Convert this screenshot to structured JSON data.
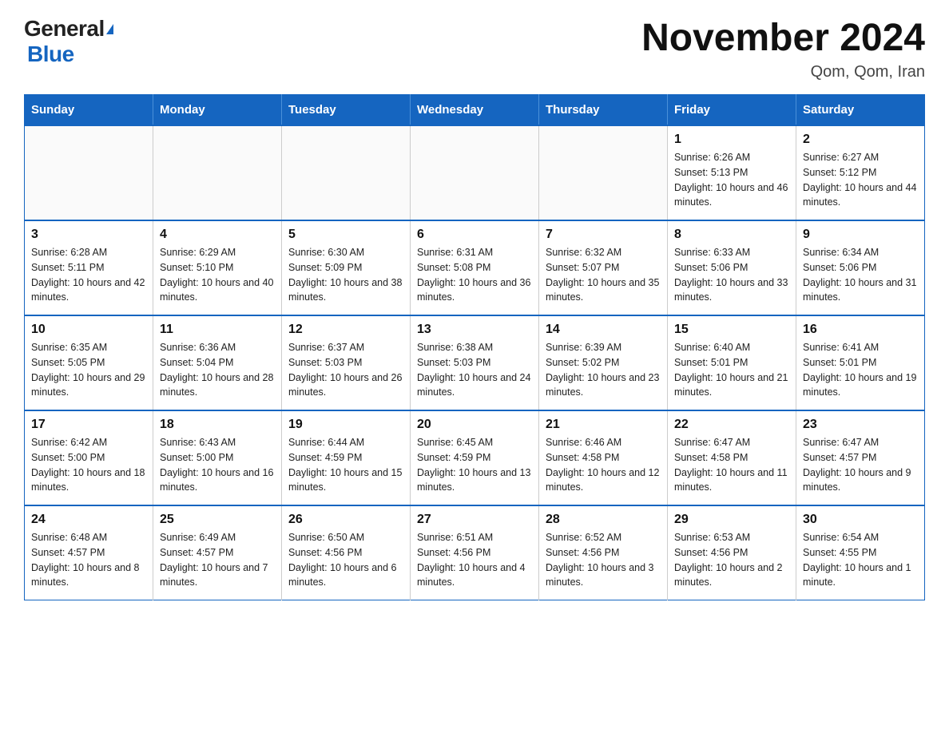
{
  "logo": {
    "general": "General",
    "triangle": "▶",
    "blue": "Blue"
  },
  "header": {
    "month": "November 2024",
    "location": "Qom, Qom, Iran"
  },
  "weekdays": [
    "Sunday",
    "Monday",
    "Tuesday",
    "Wednesday",
    "Thursday",
    "Friday",
    "Saturday"
  ],
  "weeks": [
    [
      {
        "day": "",
        "sunrise": "",
        "sunset": "",
        "daylight": ""
      },
      {
        "day": "",
        "sunrise": "",
        "sunset": "",
        "daylight": ""
      },
      {
        "day": "",
        "sunrise": "",
        "sunset": "",
        "daylight": ""
      },
      {
        "day": "",
        "sunrise": "",
        "sunset": "",
        "daylight": ""
      },
      {
        "day": "",
        "sunrise": "",
        "sunset": "",
        "daylight": ""
      },
      {
        "day": "1",
        "sunrise": "Sunrise: 6:26 AM",
        "sunset": "Sunset: 5:13 PM",
        "daylight": "Daylight: 10 hours and 46 minutes."
      },
      {
        "day": "2",
        "sunrise": "Sunrise: 6:27 AM",
        "sunset": "Sunset: 5:12 PM",
        "daylight": "Daylight: 10 hours and 44 minutes."
      }
    ],
    [
      {
        "day": "3",
        "sunrise": "Sunrise: 6:28 AM",
        "sunset": "Sunset: 5:11 PM",
        "daylight": "Daylight: 10 hours and 42 minutes."
      },
      {
        "day": "4",
        "sunrise": "Sunrise: 6:29 AM",
        "sunset": "Sunset: 5:10 PM",
        "daylight": "Daylight: 10 hours and 40 minutes."
      },
      {
        "day": "5",
        "sunrise": "Sunrise: 6:30 AM",
        "sunset": "Sunset: 5:09 PM",
        "daylight": "Daylight: 10 hours and 38 minutes."
      },
      {
        "day": "6",
        "sunrise": "Sunrise: 6:31 AM",
        "sunset": "Sunset: 5:08 PM",
        "daylight": "Daylight: 10 hours and 36 minutes."
      },
      {
        "day": "7",
        "sunrise": "Sunrise: 6:32 AM",
        "sunset": "Sunset: 5:07 PM",
        "daylight": "Daylight: 10 hours and 35 minutes."
      },
      {
        "day": "8",
        "sunrise": "Sunrise: 6:33 AM",
        "sunset": "Sunset: 5:06 PM",
        "daylight": "Daylight: 10 hours and 33 minutes."
      },
      {
        "day": "9",
        "sunrise": "Sunrise: 6:34 AM",
        "sunset": "Sunset: 5:06 PM",
        "daylight": "Daylight: 10 hours and 31 minutes."
      }
    ],
    [
      {
        "day": "10",
        "sunrise": "Sunrise: 6:35 AM",
        "sunset": "Sunset: 5:05 PM",
        "daylight": "Daylight: 10 hours and 29 minutes."
      },
      {
        "day": "11",
        "sunrise": "Sunrise: 6:36 AM",
        "sunset": "Sunset: 5:04 PM",
        "daylight": "Daylight: 10 hours and 28 minutes."
      },
      {
        "day": "12",
        "sunrise": "Sunrise: 6:37 AM",
        "sunset": "Sunset: 5:03 PM",
        "daylight": "Daylight: 10 hours and 26 minutes."
      },
      {
        "day": "13",
        "sunrise": "Sunrise: 6:38 AM",
        "sunset": "Sunset: 5:03 PM",
        "daylight": "Daylight: 10 hours and 24 minutes."
      },
      {
        "day": "14",
        "sunrise": "Sunrise: 6:39 AM",
        "sunset": "Sunset: 5:02 PM",
        "daylight": "Daylight: 10 hours and 23 minutes."
      },
      {
        "day": "15",
        "sunrise": "Sunrise: 6:40 AM",
        "sunset": "Sunset: 5:01 PM",
        "daylight": "Daylight: 10 hours and 21 minutes."
      },
      {
        "day": "16",
        "sunrise": "Sunrise: 6:41 AM",
        "sunset": "Sunset: 5:01 PM",
        "daylight": "Daylight: 10 hours and 19 minutes."
      }
    ],
    [
      {
        "day": "17",
        "sunrise": "Sunrise: 6:42 AM",
        "sunset": "Sunset: 5:00 PM",
        "daylight": "Daylight: 10 hours and 18 minutes."
      },
      {
        "day": "18",
        "sunrise": "Sunrise: 6:43 AM",
        "sunset": "Sunset: 5:00 PM",
        "daylight": "Daylight: 10 hours and 16 minutes."
      },
      {
        "day": "19",
        "sunrise": "Sunrise: 6:44 AM",
        "sunset": "Sunset: 4:59 PM",
        "daylight": "Daylight: 10 hours and 15 minutes."
      },
      {
        "day": "20",
        "sunrise": "Sunrise: 6:45 AM",
        "sunset": "Sunset: 4:59 PM",
        "daylight": "Daylight: 10 hours and 13 minutes."
      },
      {
        "day": "21",
        "sunrise": "Sunrise: 6:46 AM",
        "sunset": "Sunset: 4:58 PM",
        "daylight": "Daylight: 10 hours and 12 minutes."
      },
      {
        "day": "22",
        "sunrise": "Sunrise: 6:47 AM",
        "sunset": "Sunset: 4:58 PM",
        "daylight": "Daylight: 10 hours and 11 minutes."
      },
      {
        "day": "23",
        "sunrise": "Sunrise: 6:47 AM",
        "sunset": "Sunset: 4:57 PM",
        "daylight": "Daylight: 10 hours and 9 minutes."
      }
    ],
    [
      {
        "day": "24",
        "sunrise": "Sunrise: 6:48 AM",
        "sunset": "Sunset: 4:57 PM",
        "daylight": "Daylight: 10 hours and 8 minutes."
      },
      {
        "day": "25",
        "sunrise": "Sunrise: 6:49 AM",
        "sunset": "Sunset: 4:57 PM",
        "daylight": "Daylight: 10 hours and 7 minutes."
      },
      {
        "day": "26",
        "sunrise": "Sunrise: 6:50 AM",
        "sunset": "Sunset: 4:56 PM",
        "daylight": "Daylight: 10 hours and 6 minutes."
      },
      {
        "day": "27",
        "sunrise": "Sunrise: 6:51 AM",
        "sunset": "Sunset: 4:56 PM",
        "daylight": "Daylight: 10 hours and 4 minutes."
      },
      {
        "day": "28",
        "sunrise": "Sunrise: 6:52 AM",
        "sunset": "Sunset: 4:56 PM",
        "daylight": "Daylight: 10 hours and 3 minutes."
      },
      {
        "day": "29",
        "sunrise": "Sunrise: 6:53 AM",
        "sunset": "Sunset: 4:56 PM",
        "daylight": "Daylight: 10 hours and 2 minutes."
      },
      {
        "day": "30",
        "sunrise": "Sunrise: 6:54 AM",
        "sunset": "Sunset: 4:55 PM",
        "daylight": "Daylight: 10 hours and 1 minute."
      }
    ]
  ]
}
